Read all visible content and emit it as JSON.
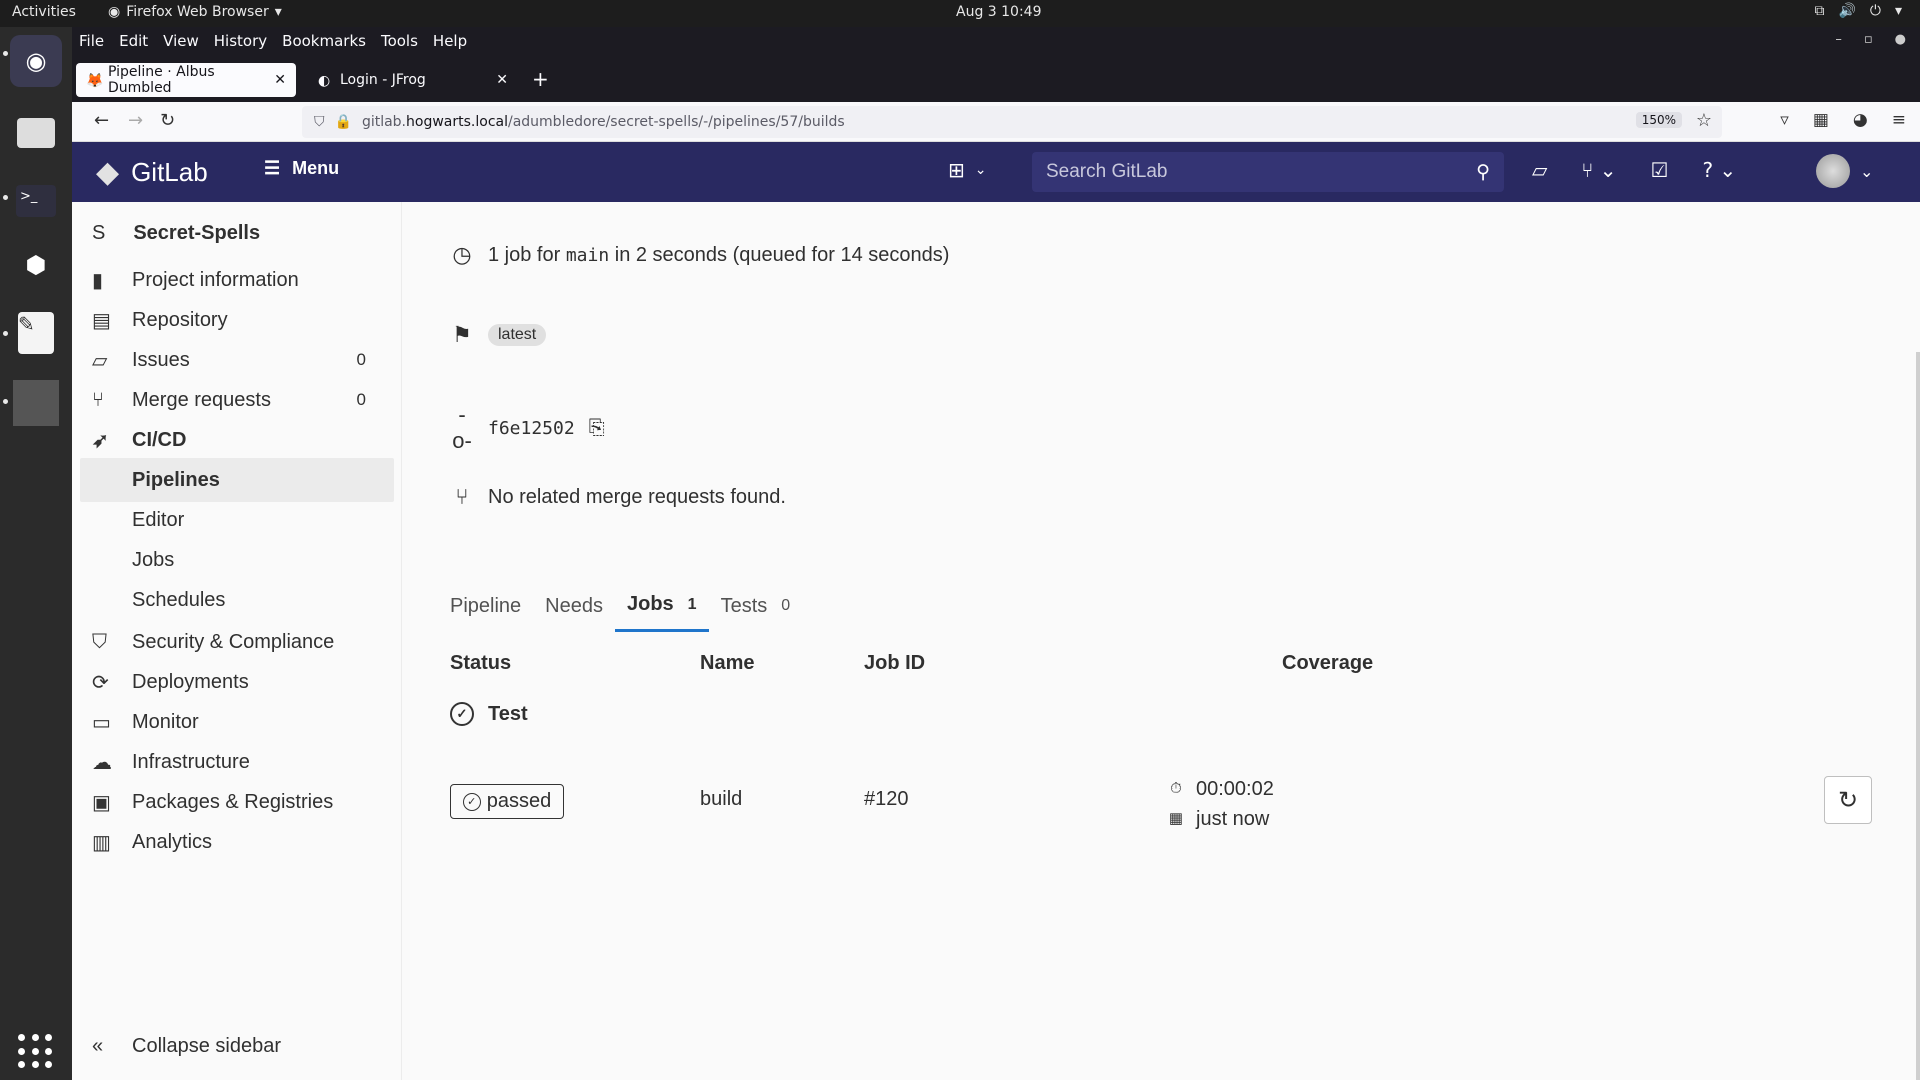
{
  "os": {
    "activities": "Activities",
    "app_name": "Firefox Web Browser",
    "clock": "Aug 3  10:49"
  },
  "firefox": {
    "menus": [
      "File",
      "Edit",
      "View",
      "History",
      "Bookmarks",
      "Tools",
      "Help"
    ],
    "tabs": [
      {
        "title": "Pipeline · Albus Dumbled",
        "active": true
      },
      {
        "title": "Login - JFrog",
        "active": false
      }
    ],
    "url_prefix": "gitlab.",
    "url_host": "hogwarts.local",
    "url_path": "/adumbledore/secret-spells/-/pipelines/57/builds",
    "zoom": "150%"
  },
  "gitlab": {
    "brand": "GitLab",
    "brand_color": "#292961",
    "menu_label": "Menu",
    "search_placeholder": "Search GitLab"
  },
  "sidebar": {
    "project_letter": "S",
    "project_name": "Secret-Spells",
    "items": [
      {
        "label": "Project information",
        "icon": "book-icon"
      },
      {
        "label": "Repository",
        "icon": "document-icon"
      },
      {
        "label": "Issues",
        "icon": "issues-icon",
        "count": "0"
      },
      {
        "label": "Merge requests",
        "icon": "merge-request-icon",
        "count": "0"
      },
      {
        "label": "CI/CD",
        "icon": "rocket-icon"
      },
      {
        "label": "Pipelines"
      },
      {
        "label": "Editor"
      },
      {
        "label": "Jobs"
      },
      {
        "label": "Schedules"
      },
      {
        "label": "Security & Compliance",
        "icon": "shield-icon"
      },
      {
        "label": "Deployments",
        "icon": "deployments-icon"
      },
      {
        "label": "Monitor",
        "icon": "monitor-icon"
      },
      {
        "label": "Infrastructure",
        "icon": "cloud-icon"
      },
      {
        "label": "Packages & Registries",
        "icon": "package-icon"
      },
      {
        "label": "Analytics",
        "icon": "chart-icon"
      }
    ],
    "collapse_label": "Collapse sidebar"
  },
  "pipeline": {
    "summary_prefix": "1 job for",
    "ref": "main",
    "summary_suffix": "in 2 seconds (queued for 14 seconds)",
    "badge": "latest",
    "commit_sha": "f6e12502",
    "merge_requests": "No related merge requests found.",
    "tabs": [
      {
        "label": "Pipeline",
        "count": ""
      },
      {
        "label": "Needs",
        "count": ""
      },
      {
        "label": "Jobs",
        "count": "1"
      },
      {
        "label": "Tests",
        "count": "0"
      }
    ],
    "columns": [
      "Status",
      "Name",
      "Job ID",
      "Coverage"
    ],
    "stage": "Test",
    "job": {
      "status": "passed",
      "name": "build",
      "id": "#120",
      "duration": "00:00:02",
      "finished": "just now"
    }
  }
}
